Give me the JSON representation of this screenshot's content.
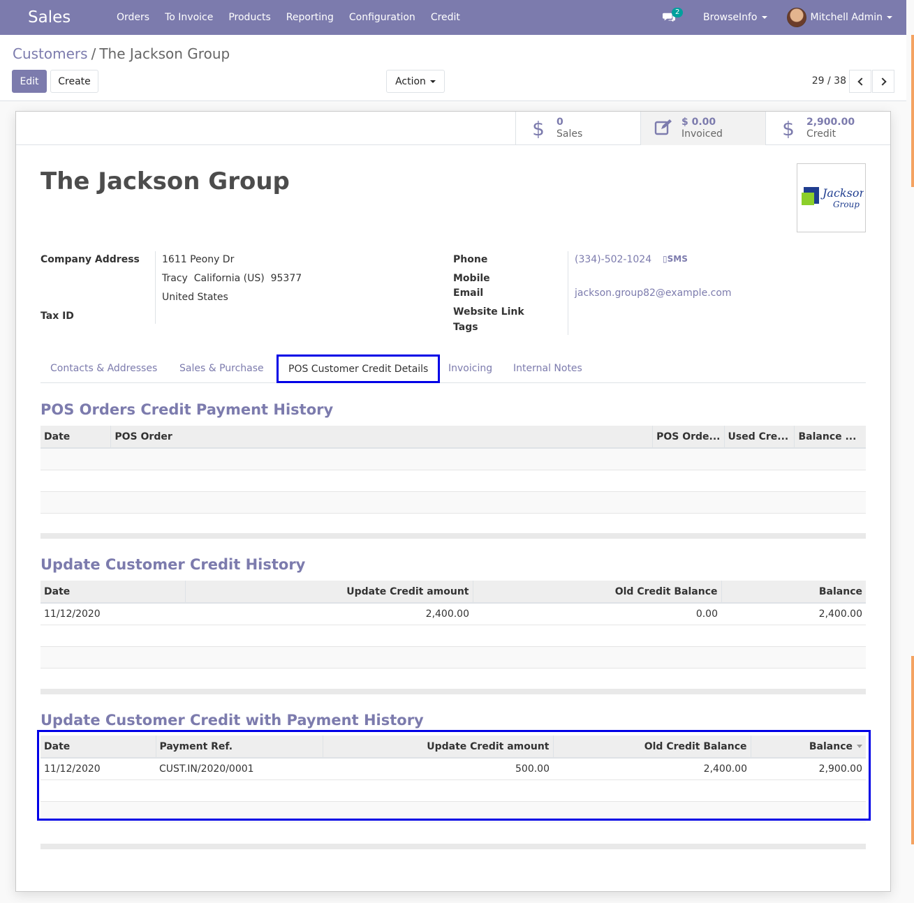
{
  "navbar": {
    "app_name": "Sales",
    "menu": [
      "Orders",
      "To Invoice",
      "Products",
      "Reporting",
      "Configuration",
      "Credit"
    ],
    "chat_count": "2",
    "company": "BrowseInfo",
    "user": "Mitchell Admin"
  },
  "breadcrumb": {
    "parent": "Customers",
    "separator": "/",
    "current": "The Jackson Group"
  },
  "buttons": {
    "edit": "Edit",
    "create": "Create",
    "action": "Action"
  },
  "pager": {
    "value": "29 / 38"
  },
  "stats": [
    {
      "value": "0",
      "label": "Sales",
      "icon": "dollar-icon"
    },
    {
      "value": "$ 0.00",
      "label": "Invoiced",
      "icon": "edit-icon"
    },
    {
      "value": "2,900.00",
      "label": "Credit",
      "icon": "dollar-icon"
    }
  ],
  "partner": {
    "name": "The Jackson Group",
    "labels": {
      "address": "Company Address",
      "tax_id": "Tax ID",
      "phone": "Phone",
      "mobile": "Mobile",
      "email": "Email",
      "website": "Website Link",
      "tags": "Tags"
    },
    "street": "1611 Peony Dr",
    "city_line": "Tracy  California (US)  95377",
    "country": "United States",
    "phone": "(334)-502-1024",
    "sms": "SMS",
    "email": "jackson.group82@example.com",
    "logo_text_1": "Jackson",
    "logo_text_2": "Group"
  },
  "tabs": [
    "Contacts & Addresses",
    "Sales & Purchase",
    "POS Customer Credit Details",
    "Invoicing",
    "Internal Notes"
  ],
  "sections": {
    "pos_orders": {
      "title": "POS Orders Credit Payment History",
      "headers": [
        "Date",
        "POS Order",
        "POS Orde...",
        "Used Cre...",
        "Balance ..."
      ]
    },
    "update_credit": {
      "title": "Update Customer Credit History",
      "headers": [
        "Date",
        "Update Credit amount",
        "Old Credit Balance",
        "Balance"
      ],
      "rows": [
        [
          "11/12/2020",
          "2,400.00",
          "0.00",
          "2,400.00"
        ]
      ]
    },
    "payment_credit": {
      "title": "Update Customer Credit with Payment History",
      "headers": [
        "Date",
        "Payment Ref.",
        "Update Credit amount",
        "Old Credit Balance",
        "Balance"
      ],
      "rows": [
        [
          "11/12/2020",
          "CUST.IN/2020/0001",
          "500.00",
          "2,400.00",
          "2,900.00"
        ]
      ]
    }
  },
  "colors": {
    "brand": "#7c7bad",
    "highlight": "#0000e6"
  }
}
